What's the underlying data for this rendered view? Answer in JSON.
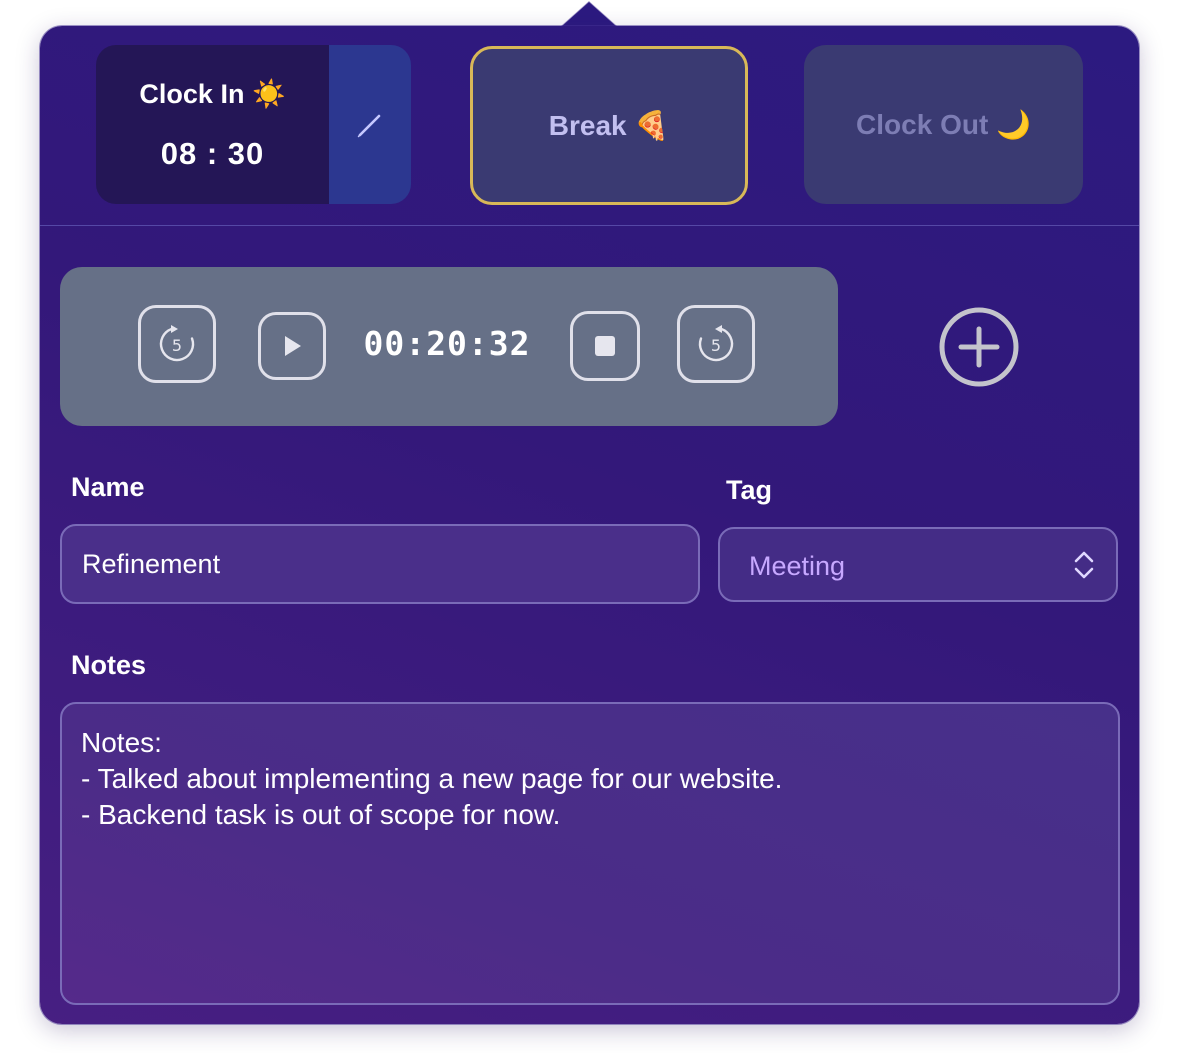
{
  "top_buttons": {
    "clock_in": {
      "label": "Clock In ☀️",
      "time": "08 : 30",
      "edit_icon": "pencil-icon"
    },
    "break": {
      "label": "Break 🍕"
    },
    "clock_out": {
      "label": "Clock Out 🌙"
    }
  },
  "timer": {
    "elapsed": "00:20:32",
    "skip_back_seconds": "5",
    "skip_forward_seconds": "5",
    "icons": {
      "back": "replay-5-icon",
      "play": "play-icon",
      "stop": "stop-icon",
      "forward": "forward-5-icon",
      "add": "plus-circle-icon"
    }
  },
  "form": {
    "name_label": "Name",
    "name_value": "Refinement",
    "tag_label": "Tag",
    "tag_value": "Meeting",
    "notes_label": "Notes",
    "notes_value": "Notes:\n- Talked about implementing a new page for our website.\n- Backend task is out of scope for now."
  },
  "colors": {
    "panel": "#2c1a80",
    "clock_in_bg": "#241656",
    "edit_bg": "#2c3790",
    "break_border": "#d8b858",
    "timer_bg": "#667087",
    "tag_text": "#c7a8ff"
  }
}
